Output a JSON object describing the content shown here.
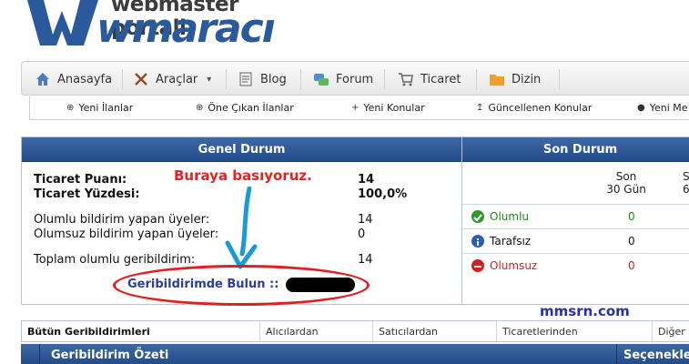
{
  "logo": {
    "top_text": "webmaster portali",
    "main_text": "wmaracı"
  },
  "nav": {
    "items": [
      {
        "label": "Anasayfa",
        "icon": "home-icon"
      },
      {
        "label": "Araçlar",
        "icon": "tools-icon",
        "dropdown": "▾"
      },
      {
        "label": "Blog",
        "icon": "blog-icon"
      },
      {
        "label": "Forum",
        "icon": "forum-icon"
      },
      {
        "label": "Ticaret",
        "icon": "cart-icon"
      },
      {
        "label": "Dizin",
        "icon": "folder-icon"
      }
    ]
  },
  "subnav": {
    "items": [
      {
        "label": "Yeni İlanlar",
        "glyph": "⊕"
      },
      {
        "label": "Öne Çıkan İlanlar",
        "glyph": "⊕"
      },
      {
        "label": "Yeni Konular",
        "glyph": "+"
      },
      {
        "label": "Güncellenen Konular",
        "glyph": "↥"
      },
      {
        "label": "Yeni Me",
        "glyph": "●"
      }
    ]
  },
  "genel": {
    "title": "Genel Durum",
    "ticaret_puani_label": "Ticaret Puanı:",
    "ticaret_puani_value": "14",
    "ticaret_yuzdesi_label": "Ticaret Yüzdesi:",
    "ticaret_yuzdesi_value": "100,0%",
    "olumlu_label": "Olumlu bildirim yapan üyeler:",
    "olumlu_value": "14",
    "olumsuz_label": "Olumsuz bildirim yapan üyeler:",
    "olumsuz_value": "0",
    "toplam_label": "Toplam olumlu geribildirim:",
    "toplam_value": "14",
    "geribildirim_link": "Geribildirimde Bulun ::"
  },
  "annotation": {
    "text": "Buraya basıyoruz."
  },
  "son": {
    "title": "Son Durum",
    "col1_line1": "Son",
    "col1_line2": "30 Gün",
    "col2_line1": "S",
    "col2_line2": "6",
    "rows": [
      {
        "label": "Olumlu",
        "value": "0",
        "color": "#1a8a1a",
        "icon": "check-circle-icon"
      },
      {
        "label": "Tarafsız",
        "value": "0",
        "color": "#111111",
        "icon": "info-circle-icon"
      },
      {
        "label": "Olumsuz",
        "value": "0",
        "color": "#d02020",
        "icon": "minus-circle-icon"
      }
    ]
  },
  "watermark": "mmsrn.com",
  "tabs": [
    {
      "label": "Bütün Geribildirimleri"
    },
    {
      "label": "Alıcılardan"
    },
    {
      "label": "Satıcılardan"
    },
    {
      "label": "Ticaretlerinden"
    },
    {
      "label": "Diğer"
    }
  ],
  "bottom": {
    "left_title": "Geribildirim Özeti",
    "right_title": "Seçenekler"
  }
}
